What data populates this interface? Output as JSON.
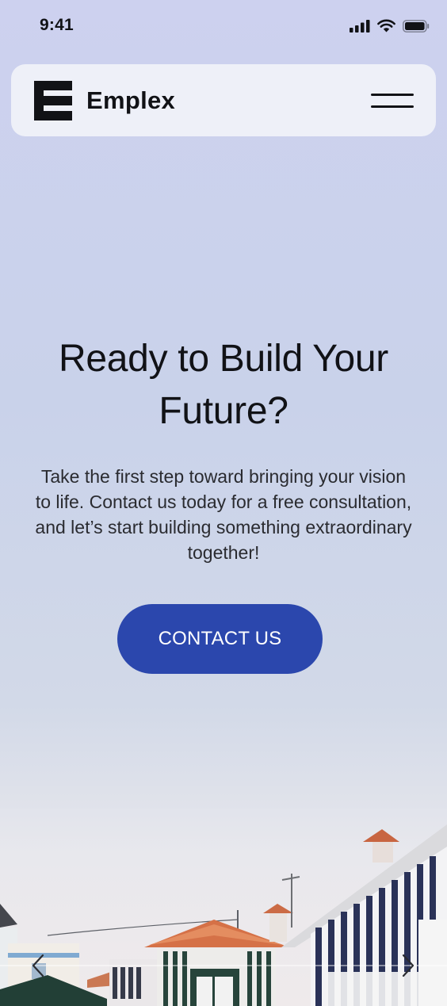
{
  "status_bar": {
    "time": "9:41",
    "icons": [
      "cellular-signal-icon",
      "wifi-icon",
      "battery-icon"
    ]
  },
  "header": {
    "brand_name": "Emplex",
    "logo_icon": "emplex-logo-icon",
    "menu_icon": "hamburger-menu-icon"
  },
  "hero": {
    "title": "Ready to Build Your Future?",
    "text": "Take the first step toward bringing your vision to life. Contact us today for a free consultation, and let’s start building something extraordinary together!",
    "cta_label": "CONTACT US"
  },
  "carousel": {
    "prev_icon": "chevron-left-icon",
    "next_icon": "chevron-right-icon"
  },
  "colors": {
    "accent": "#2b47ad",
    "header_bg": "#eef0f8",
    "text": "#111216"
  }
}
